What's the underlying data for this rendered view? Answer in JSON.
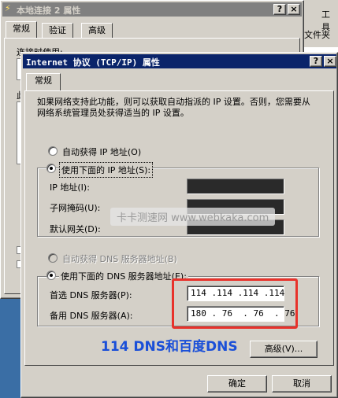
{
  "back_window": {
    "title": "本地连接 2 属性",
    "tabs": [
      "常规",
      "验证",
      "高级"
    ],
    "partial_label_1": "连接时使用:",
    "partial_label_2": "此",
    "right_toolbar_1": "工具",
    "right_toolbar_2": "文件夹"
  },
  "dialog": {
    "title": "Internet 协议 (TCP/IP) 属性",
    "help_btn": "?",
    "close_btn": "×",
    "tab": "常规",
    "intro": "如果网络支持此功能，则可以获取自动指派的 IP 设置。否则，您需要从网络系统管理员处获得适当的 IP 设置。",
    "auto_ip_label": "自动获得 IP 地址(O)",
    "manual_ip_label": "使用下面的 IP 地址(S):",
    "ip_label": "IP 地址(I):",
    "mask_label": "子网掩码(U):",
    "gateway_label": "默认网关(D):",
    "auto_dns_label": "自动获得 DNS 服务器地址(B)",
    "manual_dns_label": "使用下面的 DNS 服务器地址(E):",
    "pref_dns_label": "首选 DNS 服务器(P):",
    "alt_dns_label": "备用 DNS 服务器(A):",
    "pref_dns_value": "114 .114 .114 .114",
    "alt_dns_value": "180 . 76  . 76  . 76",
    "advanced_btn": "高级(V)...",
    "ok_btn": "确定",
    "cancel_btn": "取消"
  },
  "overlay": {
    "watermark": "卡卡测速网 www.webkaka.com",
    "caption": "114 DNS和百度DNS",
    "caption_color": "#1a4fd8",
    "highlight_color": "#e8322b"
  }
}
